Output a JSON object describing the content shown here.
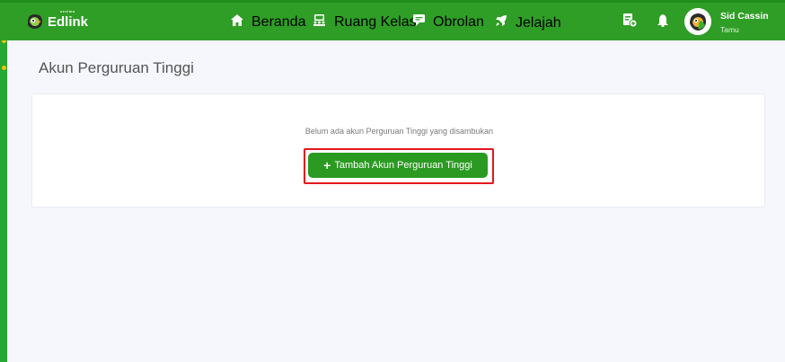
{
  "app": {
    "brand": "Edlink",
    "brand_sub": "sevima"
  },
  "nav": {
    "items": [
      {
        "label": "Beranda",
        "icon": "home-icon"
      },
      {
        "label": "Ruang Kelas",
        "icon": "classroom-icon"
      },
      {
        "label": "Obrolan",
        "icon": "chat-icon"
      },
      {
        "label": "Jelajah",
        "icon": "rocket-icon"
      }
    ]
  },
  "user": {
    "name": "Sid Cassin",
    "role": "Tamu"
  },
  "page": {
    "title": "Akun Perguruan Tinggi",
    "empty_message": "Belum ada akun Perguruan Tinggi yang disambukan",
    "add_button_label": "Tambah Akun Perguruan Tinggi",
    "add_button_icon": "plus-icon"
  },
  "colors": {
    "topbar": "#2f9e26",
    "button": "#2b9a22",
    "highlight": "#e3161d"
  }
}
